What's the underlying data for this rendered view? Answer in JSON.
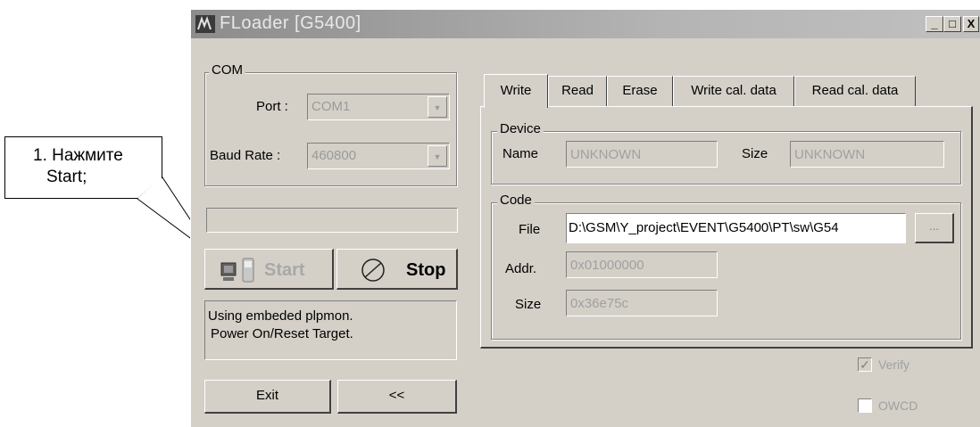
{
  "window": {
    "title": "FLoader [G5400]"
  },
  "titlebar_buttons": {
    "minimize": "_",
    "maximize": "□",
    "close": "X"
  },
  "com": {
    "legend": "COM",
    "port_label": "Port :",
    "port_value": "COM1",
    "baud_label": "Baud Rate :",
    "baud_value": "460800"
  },
  "controls": {
    "start_label": "Start",
    "stop_label": "Stop",
    "exit_label": "Exit",
    "back_label": "<<"
  },
  "status": {
    "line1": "Using embeded plpmon.",
    "line2": "Power On/Reset Target."
  },
  "tabs": [
    "Write",
    "Read",
    "Erase",
    "Write cal. data",
    "Read cal. data"
  ],
  "device": {
    "legend": "Device",
    "name_label": "Name",
    "name_value": "UNKNOWN",
    "size_label": "Size",
    "size_value": "UNKNOWN"
  },
  "code": {
    "legend": "Code",
    "file_label": "File",
    "file_value": "D:\\GSM\\Y_project\\EVENT\\G5400\\PT\\sw\\G54",
    "browse_label": "...",
    "addr_label": "Addr.",
    "addr_value": "0x01000000",
    "size_label": "Size",
    "size_value": "0x36e75c"
  },
  "options": {
    "verify_label": "Verify",
    "verify_checked": true,
    "owcd_label": "OWCD",
    "owcd_checked": false
  },
  "callout": {
    "line1": "1. Нажмите",
    "line2": "Start;"
  }
}
